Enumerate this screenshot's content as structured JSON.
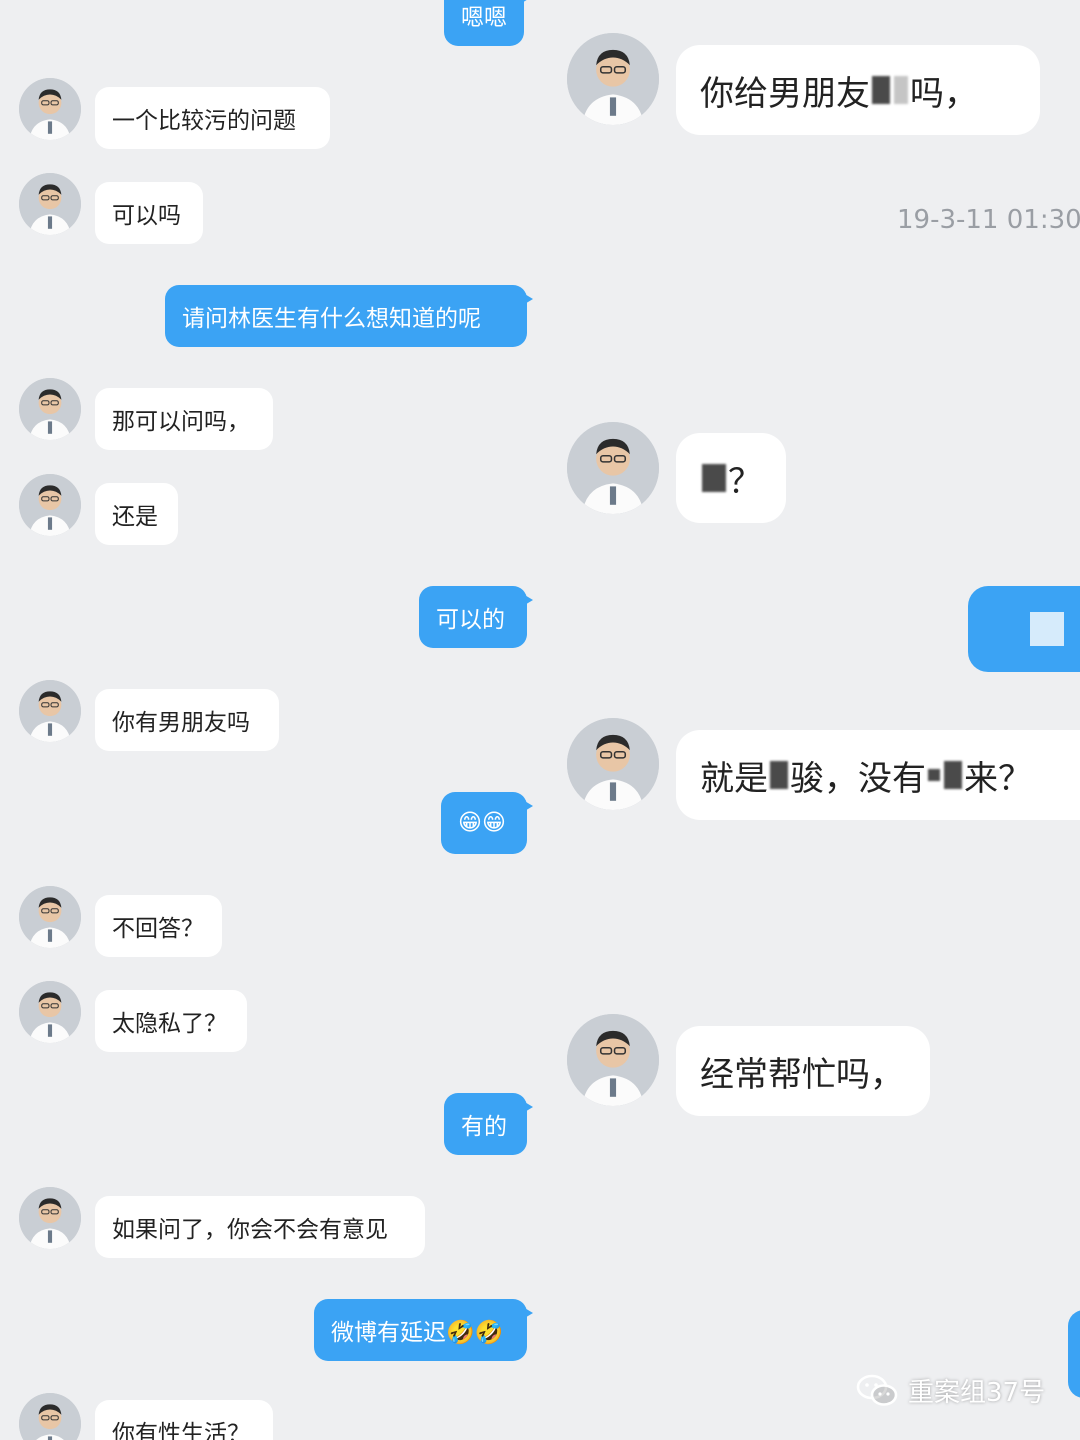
{
  "left_chat": {
    "messages": [
      {
        "side": "out",
        "text": "嗯嗯"
      },
      {
        "side": "in",
        "text": "一个比较污的问题"
      },
      {
        "side": "in",
        "text": "可以吗"
      },
      {
        "side": "out",
        "text": "请问林医生有什么想知道的呢"
      },
      {
        "side": "in",
        "text": "那可以问吗，"
      },
      {
        "side": "in",
        "text": "还是"
      },
      {
        "side": "out",
        "text": "可以的"
      },
      {
        "side": "in",
        "text": "你有男朋友吗"
      },
      {
        "side": "out",
        "text": "😁😁"
      },
      {
        "side": "in",
        "text": "不回答？"
      },
      {
        "side": "in",
        "text": "太隐私了？"
      },
      {
        "side": "out",
        "text": "有的"
      },
      {
        "side": "in",
        "text": "如果问了，你会不会有意见"
      },
      {
        "side": "out",
        "text": "微博有延迟🤣🤣"
      },
      {
        "side": "in",
        "text": "你有性生活？"
      }
    ]
  },
  "right_chat": {
    "msg1": {
      "part1": "你给男朋友",
      "part2": "吗，"
    },
    "timestamp": "19-3-11 01:30",
    "msg2": {
      "part2": "？"
    },
    "msg3": {
      "part1": "就是",
      "part2": "骏，没有",
      "part3": "来？"
    },
    "msg4": {
      "text": "经常帮忙吗，"
    }
  },
  "watermark": {
    "text": "重案组37号"
  }
}
